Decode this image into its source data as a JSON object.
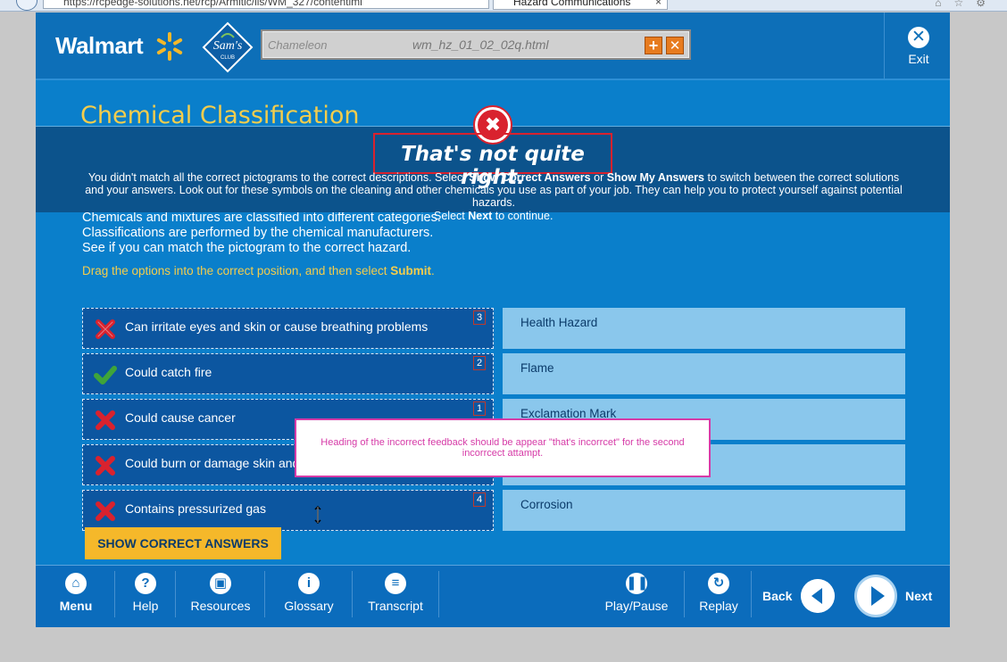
{
  "browser": {
    "address": "https://rcpedge-solutions.net/rcp/Armitic/iis/WM_327/contentlml",
    "tab_title": "Hazard Communications",
    "tab_close": "×"
  },
  "header": {
    "brand": "Walmart",
    "sams_text": "Sam's",
    "sams_sub": "CLUB",
    "chameleon_logo": "Chameleon",
    "chameleon_file": "wm_hz_01_02_02q.html",
    "plus_glyph": "+",
    "x_glyph": "✕",
    "exit_label": "Exit"
  },
  "page": {
    "title": "Chemical Classification",
    "instructions": [
      "Chemicals and mixtures are classified into different categories.",
      "Classifications are performed by the chemical manufacturers.",
      "See if you can match the pictogram to the correct hazard."
    ],
    "drag_prefix": "Drag the options into the correct position, and then select ",
    "drag_bold": "Submit",
    "drag_suffix": "."
  },
  "feedback": {
    "heading": "That's not quite right.",
    "body_1": "You didn't match all the correct pictograms to the correct descriptions. Select ",
    "body_bold_1": "Show Correct Answers",
    "body_2": " or ",
    "body_bold_2": "Show My Answers",
    "body_3": " to switch between the correct solutions and your answers.  Look out for these symbols on the cleaning and other chemicals you use as part of your job.  They can help you to protect yourself against potential hazards.",
    "next_prefix": "Select ",
    "next_bold": "Next",
    "next_suffix": " to continue."
  },
  "matches": [
    {
      "text": "Can irritate eyes and skin or cause breathing problems",
      "number": "3",
      "status": "incorrect"
    },
    {
      "text": "Could catch fire",
      "number": "2",
      "status": "correct"
    },
    {
      "text": "Could cause cancer",
      "number": "1",
      "status": "incorrect"
    },
    {
      "text": "Could burn or damage skin and e",
      "number": "",
      "status": "incorrect"
    },
    {
      "text": "Contains pressurized gas",
      "number": "4",
      "status": "incorrect"
    }
  ],
  "targets": [
    "Health Hazard",
    "Flame",
    "Exclamation Mark",
    "",
    "Corrosion"
  ],
  "review_note": "Heading of the incorrect feedback should be appear \"that's incorrcet\" for the second incorrcect attampt.",
  "show_button": "SHOW CORRECT ANSWERS",
  "footer": {
    "menu": "Menu",
    "help": "Help",
    "resources": "Resources",
    "glossary": "Glossary",
    "transcript": "Transcript",
    "playpause": "Play/Pause",
    "replay": "Replay",
    "back": "Back",
    "next": "Next"
  },
  "colors": {
    "brand_blue": "#0a7fcb",
    "gold": "#f4cd4c",
    "error_red": "#d9222e",
    "success_green": "#3fa43a",
    "note_magenta": "#d63aa7"
  }
}
